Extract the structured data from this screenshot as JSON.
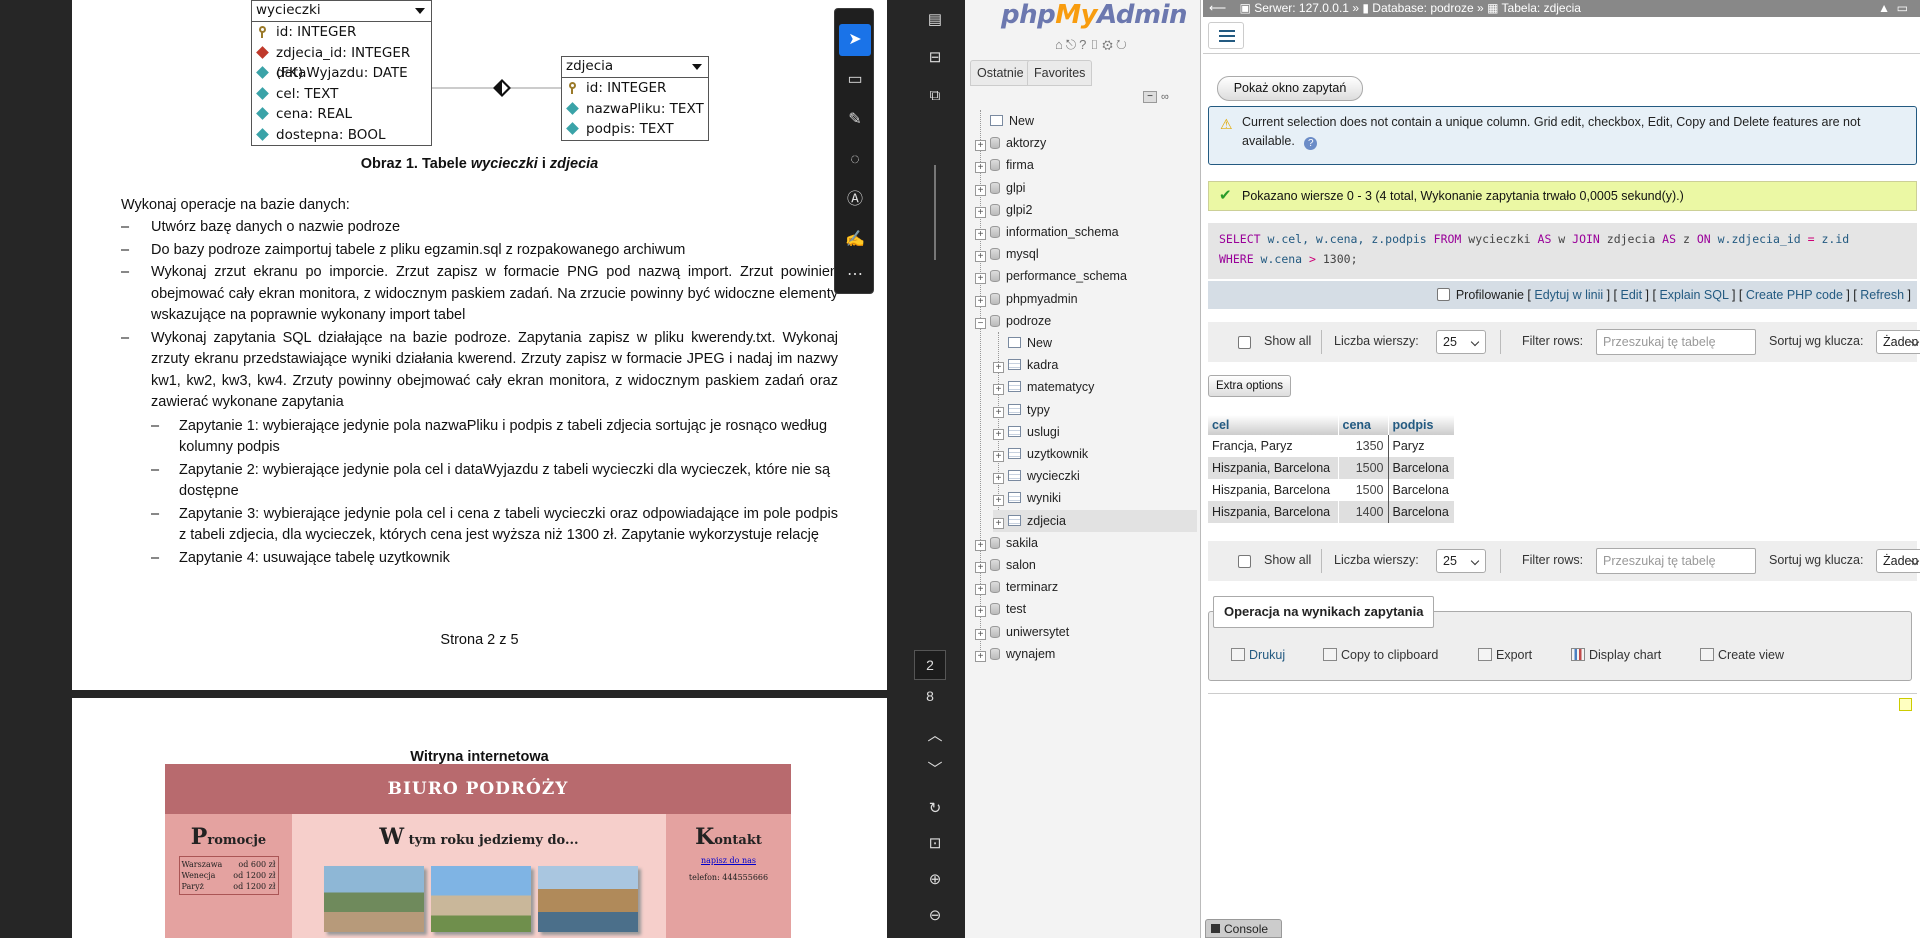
{
  "pdf": {
    "uml_wycieczki": {
      "title": "wycieczki",
      "rows": [
        "id: INTEGER",
        "zdjecia_id: INTEGER (FK)",
        "dataWyjazdu: DATE",
        "cel: TEXT",
        "cena: REAL",
        "dostepna: BOOL"
      ]
    },
    "uml_zdjecia": {
      "title": "zdjecia",
      "rows": [
        "id: INTEGER",
        "nazwaPliku: TEXT",
        "podpis: TEXT"
      ]
    },
    "caption_prefix": "Obraz 1. Tabele ",
    "caption_t1": "wycieczki",
    "caption_mid": " i ",
    "caption_t2": "zdjecia",
    "intro": "Wykonaj operacje na bazie danych:",
    "items": [
      "Utwórz bazę danych o nazwie podroze",
      "Do bazy podroze zaimportuj tabele z pliku egzamin.sql z rozpakowanego archiwum",
      "Wykonaj zrzut ekranu po imporcie. Zrzut zapisz w formacie PNG pod nazwą import. Zrzut powinien obejmować cały ekran monitora, z widocznym paskiem zadań. Na zrzucie powinny być widoczne elementy wskazujące na poprawnie wykonany import tabel",
      "Wykonaj zapytania SQL działające na bazie podroze. Zapytania zapisz w pliku kwerendy.txt. Wykonaj zrzuty ekranu przedstawiające wyniki działania kwerend. Zrzuty zapisz w formacie JPEG i nadaj im nazwy kw1, kw2, kw3, kw4. Zrzuty powinny obejmować cały ekran monitora, z widocznym paskiem zadań oraz zawierać wykonane zapytania"
    ],
    "subitems": [
      "Zapytanie 1: wybierające jedynie pola nazwaPliku i podpis z tabeli zdjecia sortując je rosnąco według kolumny podpis",
      "Zapytanie 2: wybierające jedynie pola cel i dataWyjazdu z tabeli wycieczki dla wycieczek, które nie są dostępne",
      "Zapytanie 3: wybierające jedynie pola cel i cena z tabeli wycieczki oraz odpowiadające im pole podpis z tabeli zdjecia, dla wycieczek, których cena jest wyższa niż 1300 zł. Zapytanie wykorzystuje relację",
      "Zapytanie 4: usuwające tabelę uzytkownik"
    ],
    "page_footer": "Strona 2 z 5",
    "page2_title": "Witryna internetowa",
    "site": {
      "header": "BIURO PODRÓŻY",
      "left_cap": "P",
      "left_rest": "romocje",
      "mid_cap": "W",
      "mid_rest": " tym roku jedziemy do...",
      "right_cap": "K",
      "right_rest": "ontakt",
      "promo_rows": [
        [
          "Warszawa",
          "od 600 zł"
        ],
        [
          "Wenecja",
          "od 1200 zł"
        ],
        [
          "Paryż",
          "od 1200 zł"
        ]
      ],
      "contact_link": "napisz do nas",
      "contact_phone": "telefon: 444555666"
    },
    "page_current": "2",
    "page_total": "8",
    "colors": {
      "bg": "#262626",
      "site_header": "#b86a6e",
      "site_body": "#e4a2a0"
    }
  },
  "pma": {
    "logo_php": "php",
    "logo_my": "My",
    "logo_admin": "Admin",
    "tabs": [
      "Ostatnie",
      "Favorites"
    ],
    "tree": [
      {
        "name": "New",
        "level": 0,
        "icon": "new-icon"
      },
      {
        "name": "aktorzy",
        "level": 0
      },
      {
        "name": "firma",
        "level": 0
      },
      {
        "name": "glpi",
        "level": 0
      },
      {
        "name": "glpi2",
        "level": 0
      },
      {
        "name": "information_schema",
        "level": 0
      },
      {
        "name": "mysql",
        "level": 0
      },
      {
        "name": "performance_schema",
        "level": 0
      },
      {
        "name": "phpmyadmin",
        "level": 0
      },
      {
        "name": "podroze",
        "level": 0,
        "expanded": true
      },
      {
        "name": "New",
        "level": 1,
        "icon": "new-icon"
      },
      {
        "name": "kadra",
        "level": 1
      },
      {
        "name": "matematycy",
        "level": 1
      },
      {
        "name": "typy",
        "level": 1
      },
      {
        "name": "uslugi",
        "level": 1
      },
      {
        "name": "uzytkownik",
        "level": 1
      },
      {
        "name": "wycieczki",
        "level": 1
      },
      {
        "name": "wyniki",
        "level": 1
      },
      {
        "name": "zdjecia",
        "level": 1,
        "selected": true
      },
      {
        "name": "sakila",
        "level": 0
      },
      {
        "name": "salon",
        "level": 0
      },
      {
        "name": "terminarz",
        "level": 0
      },
      {
        "name": "test",
        "level": 0
      },
      {
        "name": "uniwersytet",
        "level": 0
      },
      {
        "name": "wynajem",
        "level": 0
      }
    ],
    "breadcrumb": {
      "server": "Serwer: 127.0.0.1",
      "database": "Database: podroze",
      "table": "Tabela: zdjecia",
      "sep": "»"
    },
    "show_query_button": "Pokaż okno zapytań",
    "notice": "Current selection does not contain a unique column. Grid edit, checkbox, Edit, Copy and Delete features are not available.",
    "success": "Pokazano wiersze 0 - 3 (4 total, Wykonanie zapytania trwało 0,0005 sekund(y).)",
    "sql": {
      "line1_select": "SELECT",
      "line1_cols": " w.cel, w.cena, z.podpis ",
      "line1_from": "FROM",
      "line1_t1": " wycieczki ",
      "line1_as": "AS",
      "line1_a1": " w ",
      "line1_join": "JOIN",
      "line1_t2": " zdjecia ",
      "line1_as2": "AS",
      "line1_a2": " z ",
      "line1_on": "ON",
      "line1_cond": " w.zdjecia_id ",
      "line1_eq": "=",
      "line1_cond2": " z.id",
      "line2_where": "WHERE",
      "line2_col": " w.cena ",
      "line2_gt": ">",
      "line2_val": " 1300;"
    },
    "sql_tools": {
      "profiling": "Profilowanie",
      "links": [
        "Edytuj w linii",
        "Edit",
        "Explain SQL",
        "Create PHP code",
        "Refresh"
      ]
    },
    "nav": {
      "show_all": "Show all",
      "rows_label": "Liczba wierszy:",
      "rows_value": "25",
      "filter_label": "Filter rows:",
      "filter_placeholder": "Przeszukaj tę tabelę",
      "sort_label": "Sortuj wg klucza:",
      "sort_value": "Żaden"
    },
    "extra_options": "Extra options",
    "result": {
      "columns": [
        "cel",
        "cena",
        "podpis"
      ],
      "rows": [
        [
          "Francja, Paryz",
          "1350",
          "Paryz"
        ],
        [
          "Hiszpania, Barcelona",
          "1500",
          "Barcelona"
        ],
        [
          "Hiszpania, Barcelona",
          "1500",
          "Barcelona"
        ],
        [
          "Hiszpania, Barcelona",
          "1400",
          "Barcelona"
        ]
      ]
    },
    "ops_title": "Operacja na wynikach zapytania",
    "ops": [
      "Drukuj",
      "Copy to clipboard",
      "Export",
      "Display chart",
      "Create view"
    ],
    "console": "Console",
    "colors": {
      "accent": "#235a81",
      "notice_bg": "#e7f0f7",
      "success_bg": "#ebf8a4",
      "breadcrumb_bg": "#888888"
    }
  }
}
